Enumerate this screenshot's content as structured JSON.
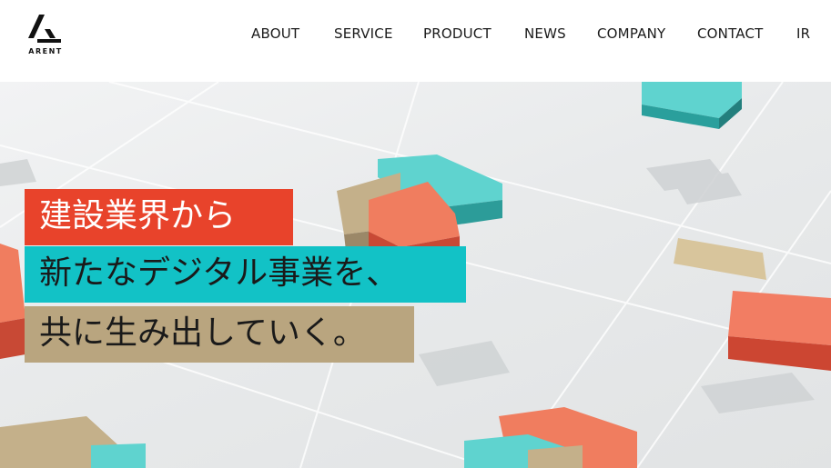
{
  "brand": {
    "logo_text": "ARENT",
    "colors": {
      "red": "#e8432b",
      "teal": "#12c2c6",
      "beige": "#b9a57f",
      "text": "#1a1a1a"
    }
  },
  "nav": {
    "items": [
      "ABOUT",
      "SERVICE",
      "PRODUCT",
      "NEWS",
      "COMPANY",
      "CONTACT",
      "IR"
    ]
  },
  "hero": {
    "tagline_lines": [
      "建設業界から",
      "新たなデジタル事業を、",
      "共に生み出していく。"
    ]
  }
}
